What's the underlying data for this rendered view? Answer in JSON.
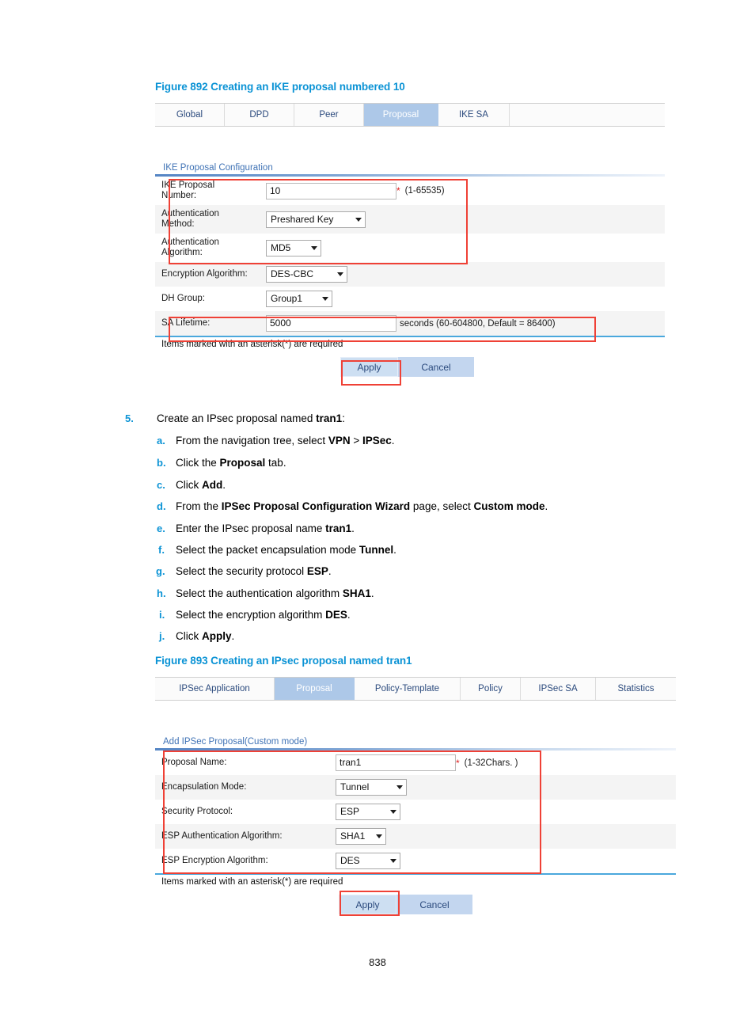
{
  "page": {
    "number": "838"
  },
  "figure1": {
    "caption": "Figure 892 Creating an IKE proposal numbered 10",
    "tabs": [
      {
        "label": "Global",
        "active": false
      },
      {
        "label": "DPD",
        "active": false
      },
      {
        "label": "Peer",
        "active": false
      },
      {
        "label": "Proposal",
        "active": true
      },
      {
        "label": "IKE SA",
        "active": false
      }
    ],
    "section_title": "IKE Proposal Configuration",
    "fields": [
      {
        "label": "IKE Proposal\nNumber:",
        "type": "text",
        "value": "10",
        "required": true,
        "hint": "(1-65535)"
      },
      {
        "label": "Authentication\nMethod:",
        "type": "select",
        "value": "Preshared Key",
        "required": false,
        "hint": ""
      },
      {
        "label": "Authentication\nAlgorithm:",
        "type": "select",
        "value": "MD5",
        "required": false,
        "hint": ""
      },
      {
        "label": "Encryption Algorithm:",
        "type": "select",
        "value": "DES-CBC",
        "required": false,
        "hint": ""
      },
      {
        "label": "DH Group:",
        "type": "select",
        "value": "Group1",
        "required": false,
        "hint": ""
      },
      {
        "label": "SA Lifetime:",
        "type": "text",
        "value": "5000",
        "required": false,
        "hint": "seconds (60-604800, Default = 86400)"
      }
    ],
    "required_note": "Items marked with an asterisk(*) are required",
    "apply_label": "Apply",
    "cancel_label": "Cancel"
  },
  "procedure": {
    "number": "5.",
    "intro_pre": "Create an IPsec proposal named ",
    "intro_bold": "tran1",
    "intro_post": ":",
    "substeps": [
      {
        "letter": "a.",
        "html": "From the navigation tree, select <b>VPN</b> &gt; <b>IPSec</b>."
      },
      {
        "letter": "b.",
        "html": "Click the <b>Proposal</b> tab."
      },
      {
        "letter": "c.",
        "html": "Click <b>Add</b>."
      },
      {
        "letter": "d.",
        "html": "From the <b>IPSec Proposal Configuration Wizard</b> page, select <b>Custom mode</b>."
      },
      {
        "letter": "e.",
        "html": "Enter the IPsec proposal name <b>tran1</b>."
      },
      {
        "letter": "f.",
        "html": "Select the packet encapsulation mode <b>Tunnel</b>."
      },
      {
        "letter": "g.",
        "html": "Select the security protocol <b>ESP</b>."
      },
      {
        "letter": "h.",
        "html": "Select the authentication algorithm <b>SHA1</b>."
      },
      {
        "letter": "i.",
        "html": "Select the encryption algorithm <b>DES</b>."
      },
      {
        "letter": "j.",
        "html": "Click <b>Apply</b>."
      }
    ]
  },
  "figure2": {
    "caption": "Figure 893 Creating an IPsec proposal named tran1",
    "tabs": [
      {
        "label": "IPSec Application",
        "active": false
      },
      {
        "label": "Proposal",
        "active": true
      },
      {
        "label": "Policy-Template",
        "active": false
      },
      {
        "label": "Policy",
        "active": false
      },
      {
        "label": "IPSec SA",
        "active": false
      },
      {
        "label": "Statistics",
        "active": false
      }
    ],
    "section_title": "Add IPSec Proposal(Custom mode)",
    "fields": [
      {
        "label": "Proposal Name:",
        "type": "text",
        "value": "tran1",
        "required": true,
        "hint": "(1-32Chars. )"
      },
      {
        "label": "Encapsulation Mode:",
        "type": "select",
        "value": "Tunnel",
        "required": false,
        "hint": ""
      },
      {
        "label": "Security Protocol:",
        "type": "select",
        "value": "ESP",
        "required": false,
        "hint": ""
      },
      {
        "label": "ESP Authentication Algorithm:",
        "type": "select",
        "value": "SHA1",
        "required": false,
        "hint": ""
      },
      {
        "label": "ESP Encryption Algorithm:",
        "type": "select",
        "value": "DES",
        "required": false,
        "hint": ""
      }
    ],
    "required_note": "Items marked with an asterisk(*) are required",
    "apply_label": "Apply",
    "cancel_label": "Cancel"
  },
  "colors": {
    "caption_blue": "#0b93d5",
    "tab_active_bg": "#adc8e8",
    "tab_text": "#2b4a7d",
    "annotation_red": "#ef4136",
    "section_blue": "#3f72b5",
    "button_bg": "#c3d6ef",
    "row_alt_bg": "#f4f4f4"
  }
}
